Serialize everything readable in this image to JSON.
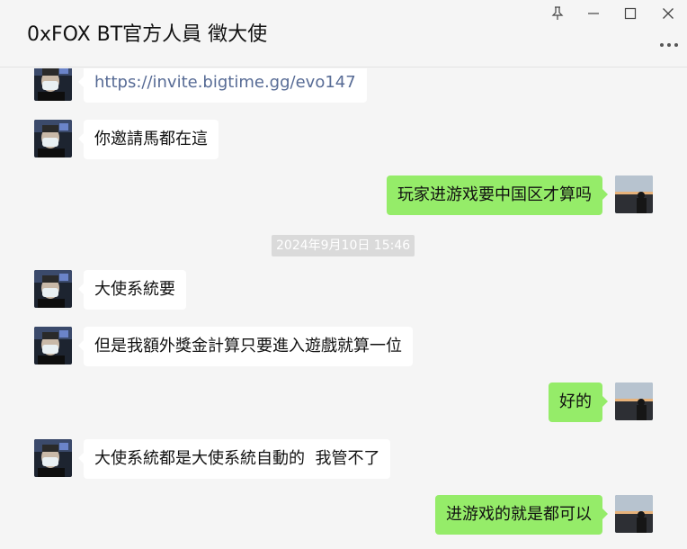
{
  "window": {
    "title": "0xFOX BT官方人員 徵大使",
    "icons": [
      "pin-icon",
      "minimize-icon",
      "maximize-icon",
      "close-icon",
      "more-icon"
    ]
  },
  "colors": {
    "outgoing_bubble": "#95ec69",
    "incoming_bubble": "#ffffff",
    "link_text": "#576b95",
    "background": "#f5f5f5"
  },
  "messages": [
    {
      "side": "incoming",
      "text": "https://invite.bigtime.gg/evo147"
    },
    {
      "side": "incoming",
      "text": "你邀請馬都在這"
    },
    {
      "side": "outgoing",
      "text": "玩家进游戏要中国区才算吗"
    },
    {
      "side": "timestamp",
      "text": "2024年9月10日 15:46"
    },
    {
      "side": "incoming",
      "text": "大使系統要"
    },
    {
      "side": "incoming",
      "text": "但是我額外獎金計算只要進入遊戲就算一位"
    },
    {
      "side": "outgoing",
      "text": "好的"
    },
    {
      "side": "incoming",
      "text": "大使系統都是大使系統自動的  我管不了"
    },
    {
      "side": "outgoing",
      "text": "进游戏的就是都可以"
    }
  ]
}
